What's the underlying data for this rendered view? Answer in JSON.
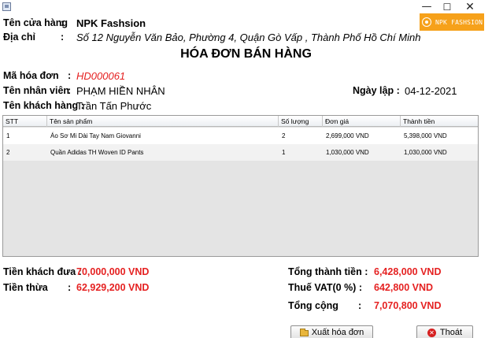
{
  "window": {
    "minimize_symbol": "—",
    "maximize_symbol": "☐",
    "close_symbol": "✕"
  },
  "logo": {
    "text": "NPK FASHSION"
  },
  "store": {
    "name_label": "Tên cửa hàng",
    "separator": ":",
    "name_value": "NPK Fashsion",
    "address_label": "Địa chỉ",
    "address_value": "Số 12 Nguyễn Văn Bảo, Phường 4, Quận Gò Vấp , Thành Phố Hồ Chí Minh"
  },
  "title": "HÓA ĐƠN BÁN HÀNG",
  "invoice": {
    "id_label": "Mã hóa đơn",
    "id_value": "HD000061",
    "employee_label": "Tên nhân viên",
    "employee_value": "PHẠM HIỀN NHÂN",
    "date_label": "Ngày lập :",
    "date_value": "04-12-2021",
    "customer_label": "Tên khách hàng :",
    "customer_value": "Trần Tấn Phước"
  },
  "table": {
    "columns": [
      "STT",
      "Tên sản phẩm",
      "Số lượng",
      "Đơn giá",
      "Thành tiền"
    ],
    "rows": [
      [
        "1",
        "Áo Sơ Mi Dài Tay Nam Giovanni",
        "2",
        "2,699,000 VND",
        "5,398,000 VND"
      ],
      [
        "2",
        "Quần Adidas TH Woven ID Pants",
        "1",
        "1,030,000 VND",
        "1,030,000 VND"
      ]
    ]
  },
  "payment": {
    "given_label": "Tiền khách đưa :",
    "given_value": "70,000,000 VND",
    "change_label": "Tiền thừa",
    "change_colon": ":",
    "change_value": "62,929,200 VND"
  },
  "totals": {
    "subtotal_label": "Tổng thành tiền :",
    "subtotal_value": "6,428,000 VND",
    "vat_label": "Thuế VAT(0 %)  :",
    "vat_value": "642,800 VND",
    "total_label": "Tổng  cộng",
    "total_colon": ":",
    "total_value": "7,070,800 VND"
  },
  "buttons": {
    "export_label": "Xuất hóa đơn",
    "exit_label": "Thoát"
  },
  "colors": {
    "accent_red": "#e52121",
    "logo_orange": "#f6a11a"
  }
}
